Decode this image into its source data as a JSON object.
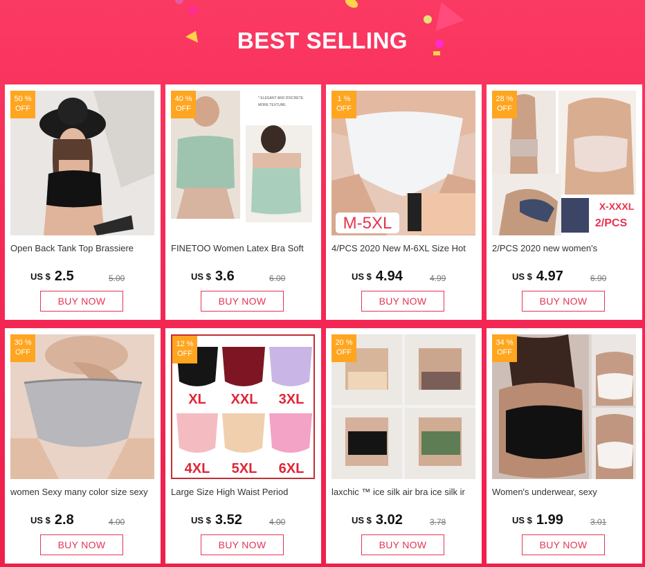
{
  "header": {
    "title": "BEST SELLING"
  },
  "colors": {
    "accent": "#e53454",
    "badge": "#ffa51f",
    "background": "#f52a57"
  },
  "products": [
    {
      "discount": "50 %",
      "off": "OFF",
      "name": "Open Back Tank Top Brassiere",
      "currency": "US $",
      "price": "2.5",
      "old_price": "5.00",
      "cta": "BUY NOW"
    },
    {
      "discount": "40 %",
      "off": "OFF",
      "name": "FINETOO Women Latex Bra Soft",
      "currency": "US $",
      "price": "3.6",
      "old_price": "6.00",
      "cta": "BUY NOW",
      "image_text": [
        "* ELEGANT AND DISCRETE.",
        "MORE TEXTURE."
      ]
    },
    {
      "discount": "1 %",
      "off": "OFF",
      "name": "4/PCS 2020 New M-6XL Size Hot",
      "currency": "US $",
      "price": "4.94",
      "old_price": "4.99",
      "cta": "BUY NOW",
      "image_text": [
        "M-5XL"
      ]
    },
    {
      "discount": "28 %",
      "off": "OFF",
      "name": "2/PCS 2020 new women's",
      "currency": "US $",
      "price": "4.97",
      "old_price": "6.90",
      "cta": "BUY NOW",
      "image_text": [
        "X-XXXL",
        "2/PCS"
      ]
    },
    {
      "discount": "30 %",
      "off": "OFF",
      "name": "women Sexy many color size sexy",
      "currency": "US $",
      "price": "2.8",
      "old_price": "4.00",
      "cta": "BUY NOW"
    },
    {
      "discount": "12 %",
      "off": "OFF",
      "name": "Large Size High Waist Period",
      "currency": "US $",
      "price": "3.52",
      "old_price": "4.00",
      "cta": "BUY NOW",
      "image_text": [
        "XL",
        "XXL",
        "3XL",
        "4XL",
        "5XL",
        "6XL"
      ]
    },
    {
      "discount": "20 %",
      "off": "OFF",
      "name": "laxchic ™ ice silk air bra ice silk ir",
      "currency": "US $",
      "price": "3.02",
      "old_price": "3.78",
      "cta": "BUY NOW"
    },
    {
      "discount": "34 %",
      "off": "OFF",
      "name": "Women's underwear, sexy",
      "currency": "US $",
      "price": "1.99",
      "old_price": "3.01",
      "cta": "BUY NOW"
    }
  ]
}
